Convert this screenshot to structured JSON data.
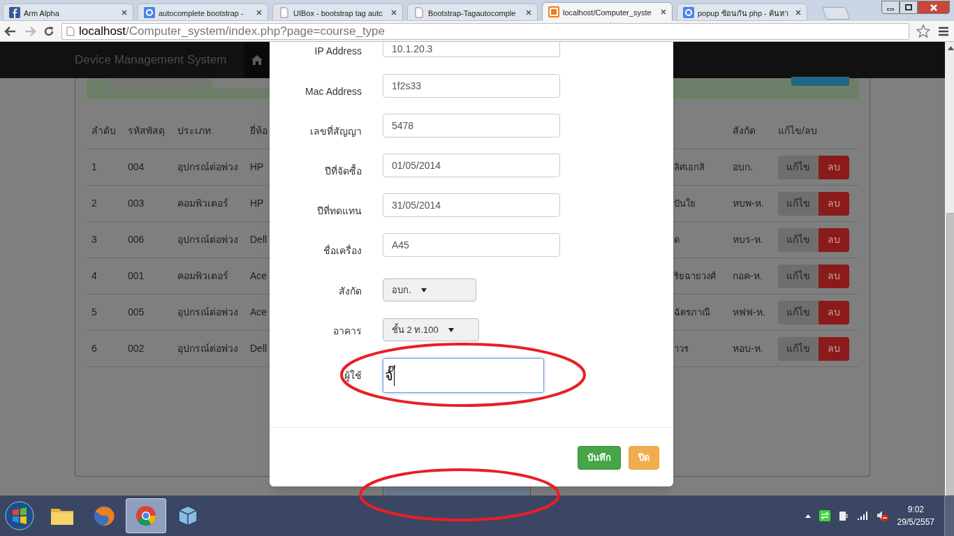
{
  "browser": {
    "tabs": [
      {
        "title": "Arm Alpha",
        "selected": false
      },
      {
        "title": "autocomplete bootstrap -",
        "selected": false
      },
      {
        "title": "UIBox - bootstrap tag autc",
        "selected": false
      },
      {
        "title": "Bootstrap-Tagautocomple",
        "selected": false
      },
      {
        "title": "localhost/Computer_syste",
        "selected": true
      },
      {
        "title": "popup ซ้อนกัน php - ค้นหา",
        "selected": false
      }
    ],
    "url_host": "localhost",
    "url_path": "/Computer_system/index.php?page=course_type"
  },
  "app": {
    "brand": "Device Management System",
    "table": {
      "columns": [
        "ลำดับ",
        "รหัสพัสดุ",
        "ประเภท",
        "ยี่ห้อ",
        "สังกัด",
        "แก้ไข/ลบ"
      ],
      "rows": [
        {
          "no": "1",
          "code": "004",
          "type": "อุปกรณ์ต่อพ่วง",
          "brand": "HP",
          "column_5": "ลิศเอกสิ",
          "unit": "อบก.",
          "edit": "แก้ไข",
          "delete": "ลบ"
        },
        {
          "no": "2",
          "code": "003",
          "type": "คอมพิวเตอร์",
          "brand": "HP",
          "column_5": "ปันใย",
          "unit": "หบพ-ห.",
          "edit": "แก้ไข",
          "delete": "ลบ"
        },
        {
          "no": "3",
          "code": "006",
          "type": "อุปกรณ์ต่อพ่วง",
          "brand": "Dell",
          "column_5": "ด",
          "unit": "หบร-ห.",
          "edit": "แก้ไข",
          "delete": "ลบ"
        },
        {
          "no": "4",
          "code": "001",
          "type": "คอมพิวเตอร์",
          "brand": "Ace",
          "column_5": "ริยฉายวงศ์",
          "unit": "กอค-ห.",
          "edit": "แก้ไข",
          "delete": "ลบ"
        },
        {
          "no": "5",
          "code": "005",
          "type": "อุปกรณ์ต่อพ่วง",
          "brand": "Ace",
          "column_5": "ฉัตรภาณี",
          "unit": "หฟฟ-ห.",
          "edit": "แก้ไข",
          "delete": "ลบ"
        },
        {
          "no": "6",
          "code": "002",
          "type": "อุปกรณ์ต่อพ่วง",
          "brand": "Dell",
          "column_5": "าวร",
          "unit": "หอบ-ห.",
          "edit": "แก้ไข",
          "delete": "ลบ"
        }
      ]
    }
  },
  "modal": {
    "fields": [
      {
        "label": "IP Address",
        "kind": "input",
        "value": "10.1.20.3",
        "focused": false
      },
      {
        "label": "Mac Address",
        "kind": "input",
        "value": "1f2s33",
        "focused": false
      },
      {
        "label": "เลขที่สัญญา",
        "kind": "input",
        "value": "5478",
        "focused": false
      },
      {
        "label": "ปีที่จัดซื้อ",
        "kind": "input",
        "value": "01/05/2014",
        "focused": false
      },
      {
        "label": "ปีที่ทดแทน",
        "kind": "input",
        "value": "31/05/2014",
        "focused": false
      },
      {
        "label": "ชื่อเครื่อง",
        "kind": "input",
        "value": "A45",
        "focused": false
      },
      {
        "label": "สังกัด",
        "kind": "select",
        "value": "อบก."
      },
      {
        "label": "อาคาร",
        "kind": "select",
        "value": "ชั้น 2 ท.100"
      },
      {
        "label": "ผู้ใช้",
        "kind": "textbox",
        "value": "จั๊",
        "focused": true
      }
    ],
    "buttons": [
      {
        "label": "บันทึก",
        "kind": "save"
      },
      {
        "label": "ปิด",
        "kind": "close"
      }
    ]
  },
  "taskbar": {
    "apps": [
      {
        "selected": false
      },
      {
        "selected": false
      },
      {
        "selected": true
      },
      {
        "selected": false
      }
    ],
    "time": "9:02",
    "date": "29/5/2557"
  }
}
